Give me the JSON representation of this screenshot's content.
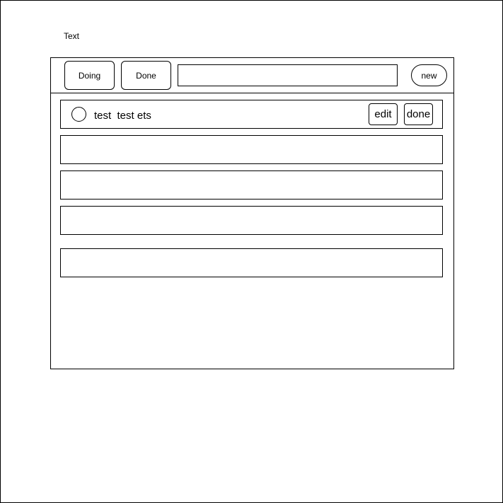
{
  "header": {
    "text": "Text"
  },
  "toolbar": {
    "doing_label": "Doing",
    "done_label": "Done",
    "search_value": "",
    "new_label": "new"
  },
  "tasks": [
    {
      "text": "test  test ets",
      "edit_label": "edit",
      "done_label": "done"
    },
    {
      "text": ""
    },
    {
      "text": ""
    },
    {
      "text": ""
    },
    {
      "text": ""
    }
  ]
}
